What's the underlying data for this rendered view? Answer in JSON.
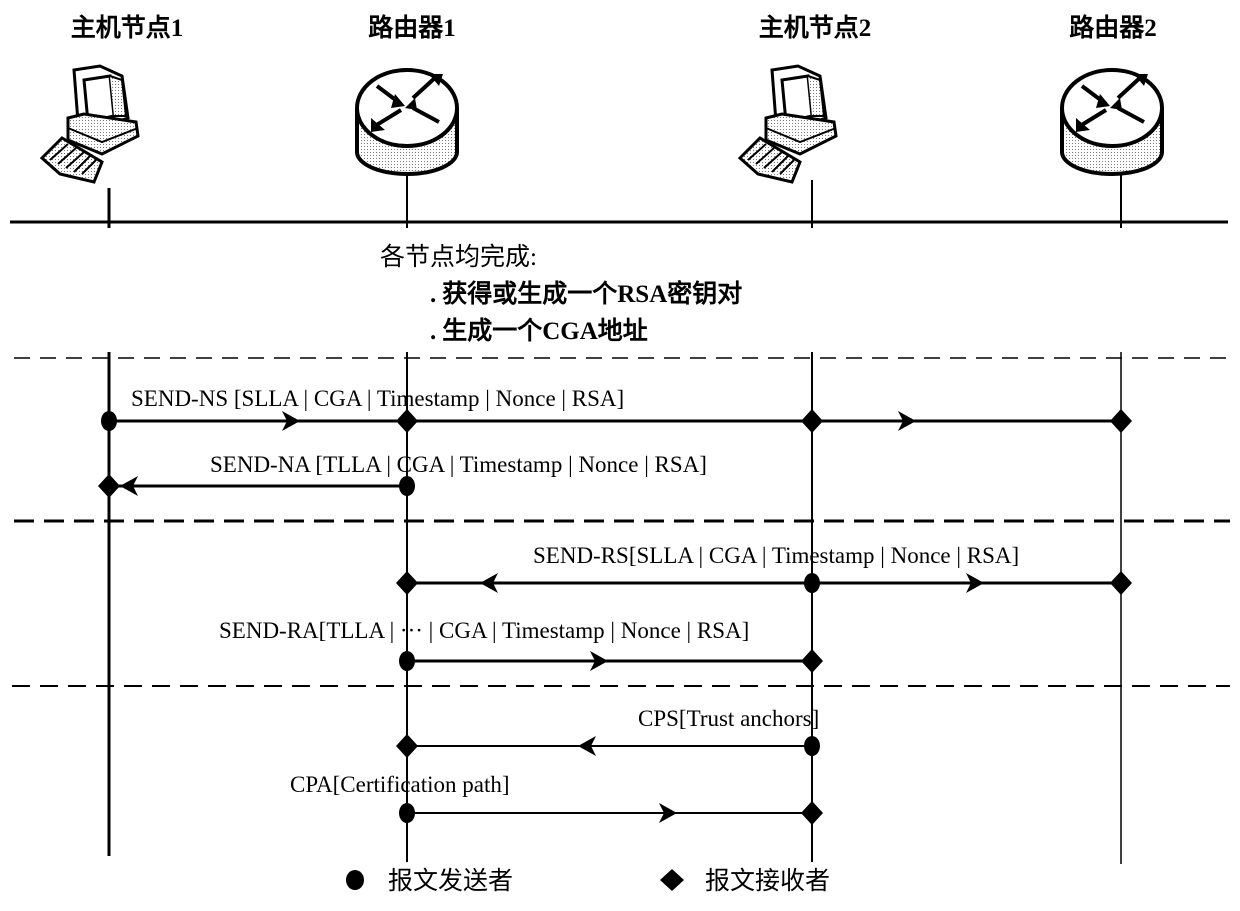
{
  "diagram": {
    "type": "sequence",
    "nodes": [
      {
        "id": "host1",
        "label": "主机节点1",
        "kind": "host-computer"
      },
      {
        "id": "router1",
        "label": "路由器1",
        "kind": "router"
      },
      {
        "id": "host2",
        "label": "主机节点2",
        "kind": "host-computer"
      },
      {
        "id": "router2",
        "label": "路由器2",
        "kind": "router"
      }
    ],
    "setup_note": {
      "heading": "各节点均完成:",
      "items": [
        {
          "bullet": ".",
          "text": "获得或生成一个RSA密钥对"
        },
        {
          "bullet": ".",
          "text": "生成一个CGA地址"
        }
      ]
    },
    "messages": [
      {
        "id": "send-ns",
        "label": "SEND-NS [SLLA | CGA | Timestamp | Nonce | RSA]",
        "sender": "host1",
        "receivers": [
          "router1",
          "host2",
          "router2"
        ],
        "direction": "right"
      },
      {
        "id": "send-na",
        "label": "SEND-NA [TLLA | CGA | Timestamp | Nonce | RSA]",
        "sender": "router1",
        "receivers": [
          "host1"
        ],
        "direction": "left"
      },
      {
        "id": "send-rs",
        "label": "SEND-RS[SLLA | CGA | Timestamp | Nonce | RSA]",
        "sender": "host2",
        "receivers": [
          "router1",
          "router2"
        ],
        "direction": "both"
      },
      {
        "id": "send-ra",
        "label": "SEND-RA[TLLA | ··· | CGA | Timestamp | Nonce | RSA]",
        "sender": "router1",
        "receivers": [
          "host2"
        ],
        "direction": "right"
      },
      {
        "id": "cps",
        "label": "CPS[Trust anchors]",
        "sender": "host2",
        "receivers": [
          "router1"
        ],
        "direction": "left"
      },
      {
        "id": "cpa",
        "label": "CPA[Certification path]",
        "sender": "router1",
        "receivers": [
          "host2"
        ],
        "direction": "right"
      }
    ],
    "legend": {
      "sender": {
        "symbol": "filled-circle",
        "label": "报文发送者"
      },
      "receiver": {
        "symbol": "filled-diamond",
        "label": "报文接收者"
      }
    }
  }
}
